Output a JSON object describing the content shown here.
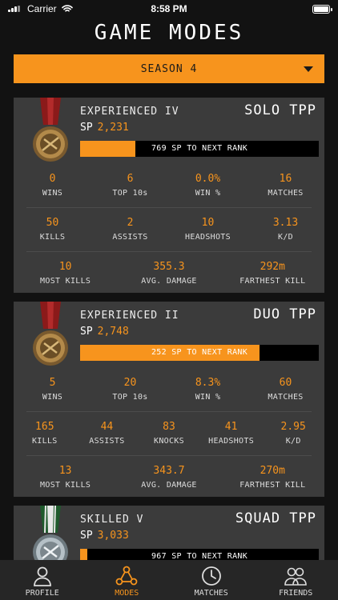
{
  "status_bar": {
    "carrier": "Carrier",
    "time": "8:58 PM"
  },
  "page_title": "GAME MODES",
  "season": {
    "selected": "SEASON 4"
  },
  "colors": {
    "accent": "#f7941d",
    "card": "#3b3b3b",
    "background": "#121212"
  },
  "modes": [
    {
      "mode": "SOLO TPP",
      "rank": "EXPERIENCED IV",
      "sp_label": "SP",
      "sp": "2,231",
      "progress_text": "769 SP TO NEXT RANK",
      "progress_fraction": 0.23,
      "medal": "bronze-medal-icon",
      "rows": [
        [
          {
            "value": "0",
            "label": "WINS"
          },
          {
            "value": "6",
            "label": "TOP 10s"
          },
          {
            "value": "0.0%",
            "label": "WIN %"
          },
          {
            "value": "16",
            "label": "MATCHES"
          }
        ],
        [
          {
            "value": "50",
            "label": "KILLS"
          },
          {
            "value": "2",
            "label": "ASSISTS"
          },
          {
            "value": "10",
            "label": "HEADSHOTS"
          },
          {
            "value": "3.13",
            "label": "K/D"
          }
        ],
        [
          {
            "value": "10",
            "label": "MOST KILLS"
          },
          {
            "value": "355.3",
            "label": "AVG. DAMAGE"
          },
          {
            "value": "292m",
            "label": "FARTHEST KILL"
          }
        ]
      ]
    },
    {
      "mode": "DUO TPP",
      "rank": "EXPERIENCED II",
      "sp_label": "SP",
      "sp": "2,748",
      "progress_text": "252 SP TO NEXT RANK",
      "progress_fraction": 0.75,
      "medal": "bronze-medal-icon",
      "rows": [
        [
          {
            "value": "5",
            "label": "WINS"
          },
          {
            "value": "20",
            "label": "TOP 10s"
          },
          {
            "value": "8.3%",
            "label": "WIN %"
          },
          {
            "value": "60",
            "label": "MATCHES"
          }
        ],
        [
          {
            "value": "165",
            "label": "KILLS"
          },
          {
            "value": "44",
            "label": "ASSISTS"
          },
          {
            "value": "83",
            "label": "KNOCKS"
          },
          {
            "value": "41",
            "label": "HEADSHOTS"
          },
          {
            "value": "2.95",
            "label": "K/D"
          }
        ],
        [
          {
            "value": "13",
            "label": "MOST KILLS"
          },
          {
            "value": "343.7",
            "label": "AVG. DAMAGE"
          },
          {
            "value": "270m",
            "label": "FARTHEST KILL"
          }
        ]
      ]
    },
    {
      "mode": "SQUAD TPP",
      "rank": "SKILLED V",
      "sp_label": "SP",
      "sp": "3,033",
      "progress_text": "967 SP TO NEXT RANK",
      "progress_fraction": 0.03,
      "medal": "silver-medal-icon"
    }
  ],
  "tabs": [
    {
      "label": "PROFILE",
      "icon": "person-icon",
      "active": false
    },
    {
      "label": "MODES",
      "icon": "modes-icon",
      "active": true
    },
    {
      "label": "MATCHES",
      "icon": "clock-icon",
      "active": false
    },
    {
      "label": "FRIENDS",
      "icon": "friends-icon",
      "active": false
    }
  ]
}
